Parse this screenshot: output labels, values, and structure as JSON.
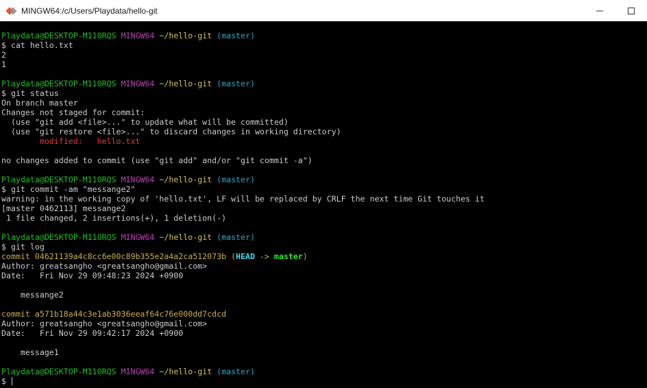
{
  "window": {
    "title": "MINGW64:/c/Users/Playdata/hello-git"
  },
  "terminal": {
    "lines": [
      {
        "kind": "prompt",
        "user": "Playdata@DESKTOP-M110RQS",
        "sys": "MINGW64",
        "path": "~/hello-git",
        "branch": "(master)"
      },
      {
        "kind": "text",
        "text": "$ cat hello.txt"
      },
      {
        "kind": "text",
        "text": "2"
      },
      {
        "kind": "text",
        "text": "1"
      },
      {
        "kind": "blank"
      },
      {
        "kind": "prompt",
        "user": "Playdata@DESKTOP-M110RQS",
        "sys": "MINGW64",
        "path": "~/hello-git",
        "branch": "(master)"
      },
      {
        "kind": "text",
        "text": "$ git status"
      },
      {
        "kind": "text",
        "text": "On branch master"
      },
      {
        "kind": "text",
        "text": "Changes not staged for commit:"
      },
      {
        "kind": "text",
        "text": "  (use \"git add <file>...\" to update what will be committed)"
      },
      {
        "kind": "text",
        "text": "  (use \"git restore <file>...\" to discard changes in working directory)"
      },
      {
        "kind": "modified",
        "indent": "        ",
        "label": "modified:   ",
        "file": "hello.txt"
      },
      {
        "kind": "blank"
      },
      {
        "kind": "text",
        "text": "no changes added to commit (use \"git add\" and/or \"git commit -a\")"
      },
      {
        "kind": "blank"
      },
      {
        "kind": "prompt",
        "user": "Playdata@DESKTOP-M110RQS",
        "sys": "MINGW64",
        "path": "~/hello-git",
        "branch": "(master)"
      },
      {
        "kind": "text",
        "text": "$ git commit -am \"messange2\""
      },
      {
        "kind": "text",
        "text": "warning: in the working copy of 'hello.txt', LF will be replaced by CRLF the next time Git touches it"
      },
      {
        "kind": "text",
        "text": "[master 0462113] messange2"
      },
      {
        "kind": "text",
        "text": " 1 file changed, 2 insertions(+), 1 deletion(-)"
      },
      {
        "kind": "blank"
      },
      {
        "kind": "prompt",
        "user": "Playdata@DESKTOP-M110RQS",
        "sys": "MINGW64",
        "path": "~/hello-git",
        "branch": "(master)"
      },
      {
        "kind": "text",
        "text": "$ git log"
      },
      {
        "kind": "commit_head",
        "commit": "commit 04621139a4c8cc6e00c89b355e2a4a2ca512073b",
        "open": " (",
        "head": "HEAD",
        "arrow": " -> ",
        "master": "master",
        "close": ")"
      },
      {
        "kind": "text",
        "text": "Author: greatsangho <greatsangho@gmail.com>"
      },
      {
        "kind": "text",
        "text": "Date:   Fri Nov 29 09:48:23 2024 +0900"
      },
      {
        "kind": "blank"
      },
      {
        "kind": "text",
        "text": "    messange2"
      },
      {
        "kind": "blank"
      },
      {
        "kind": "commit",
        "commit": "commit a571b18a44c3e1ab3036eeaf64c76e000dd7cdcd"
      },
      {
        "kind": "text",
        "text": "Author: greatsangho <greatsangho@gmail.com>"
      },
      {
        "kind": "text",
        "text": "Date:   Fri Nov 29 09:42:17 2024 +0900"
      },
      {
        "kind": "blank"
      },
      {
        "kind": "text",
        "text": "    message1"
      },
      {
        "kind": "blank"
      },
      {
        "kind": "prompt",
        "user": "Playdata@DESKTOP-M110RQS",
        "sys": "MINGW64",
        "path": "~/hello-git",
        "branch": "(master)"
      },
      {
        "kind": "cursor",
        "text": "$ "
      }
    ]
  },
  "colors": {
    "background": "#000000",
    "foreground": "#cccccc",
    "prompt_user": "#1cc21c",
    "prompt_sys": "#bc3fbc",
    "prompt_path": "#d4c45e",
    "prompt_branch": "#2aa7c8",
    "modified": "#e03c3c",
    "commit_hash": "#c8b04a"
  },
  "icons": {
    "app": "git-bash-icon",
    "minimize": "minimize-icon",
    "maximize": "maximize-icon"
  }
}
